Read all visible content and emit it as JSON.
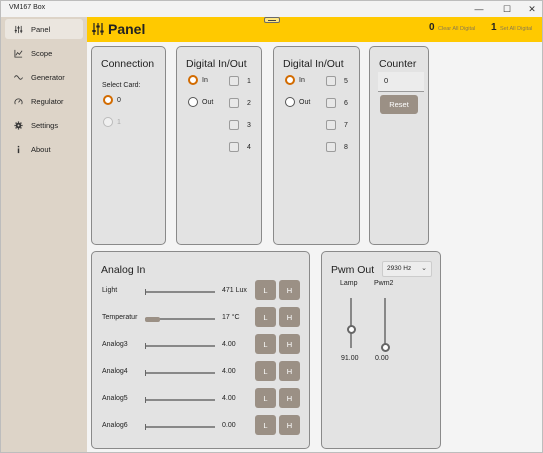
{
  "window": {
    "title": "VM167 Box"
  },
  "sidebar": {
    "items": [
      {
        "label": "Panel",
        "icon": "sliders-icon",
        "active": true
      },
      {
        "label": "Scope",
        "icon": "chart-icon",
        "active": false
      },
      {
        "label": "Generator",
        "icon": "wave-icon",
        "active": false
      },
      {
        "label": "Regulator",
        "icon": "gauge-icon",
        "active": false
      },
      {
        "label": "Settings",
        "icon": "gear-icon",
        "active": false
      },
      {
        "label": "About",
        "icon": "info-icon",
        "active": false
      }
    ]
  },
  "header": {
    "title": "Panel",
    "clear_count": "0",
    "clear_label": "Clear All Digital",
    "set_count": "1",
    "set_label": "Set All Digital",
    "accent": "#ffc900"
  },
  "connection": {
    "title": "Connection",
    "select_label": "Select Card:",
    "cards": [
      {
        "label": "0",
        "selected": true,
        "enabled": true
      },
      {
        "label": "1",
        "selected": false,
        "enabled": false
      }
    ]
  },
  "digital1": {
    "title": "Digital In/Out",
    "in_label": "In",
    "out_label": "Out",
    "mode": "In",
    "channels": [
      "1",
      "2",
      "3",
      "4"
    ]
  },
  "digital2": {
    "title": "Digital In/Out",
    "in_label": "In",
    "out_label": "Out",
    "mode": "In",
    "channels": [
      "5",
      "6",
      "7",
      "8"
    ]
  },
  "counter": {
    "title": "Counter",
    "value": "0",
    "reset_label": "Reset"
  },
  "analog": {
    "title": "Analog In",
    "low_label": "L",
    "high_label": "H",
    "rows": [
      {
        "name": "Light",
        "value": "471 Lux",
        "level": 0.0
      },
      {
        "name": "Temperatur",
        "value": "17 °C",
        "level": 0.22
      },
      {
        "name": "Analog3",
        "value": "4.00",
        "level": 0.0
      },
      {
        "name": "Analog4",
        "value": "4.00",
        "level": 0.0
      },
      {
        "name": "Analog5",
        "value": "4.00",
        "level": 0.0
      },
      {
        "name": "Analog6",
        "value": "0.00",
        "level": 0.0
      }
    ]
  },
  "pwm": {
    "title": "Pwm Out",
    "frequency": "2930 Hz",
    "channels": [
      {
        "name": "Lamp",
        "value": "91.00",
        "level": 0.36
      },
      {
        "name": "Pwm2",
        "value": "0.00",
        "level": 0.0
      }
    ]
  }
}
